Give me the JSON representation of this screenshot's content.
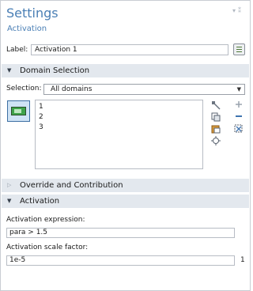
{
  "header": {
    "title": "Settings",
    "subtitle": "Activation"
  },
  "label_row": {
    "label": "Label:",
    "value": "Activation 1"
  },
  "domain_selection": {
    "header": "Domain Selection",
    "selection_label": "Selection:",
    "selection_value": "All domains",
    "items": [
      "1",
      "2",
      "3"
    ]
  },
  "override": {
    "header": "Override and Contribution"
  },
  "activation": {
    "header": "Activation",
    "expr_label": "Activation expression:",
    "expr_value": "para > 1.5",
    "scale_label": "Activation scale factor:",
    "scale_value": "1e-5",
    "scale_unit": "1"
  },
  "icons": {
    "label_button": "edit-label-icon",
    "domain_button": "domain-select-icon",
    "toolbar": [
      "paste-icon",
      "copy-icon",
      "clipboard-icon",
      "zoom-to-selection-icon",
      "add-icon",
      "remove-icon",
      "clear-selection-icon"
    ]
  }
}
